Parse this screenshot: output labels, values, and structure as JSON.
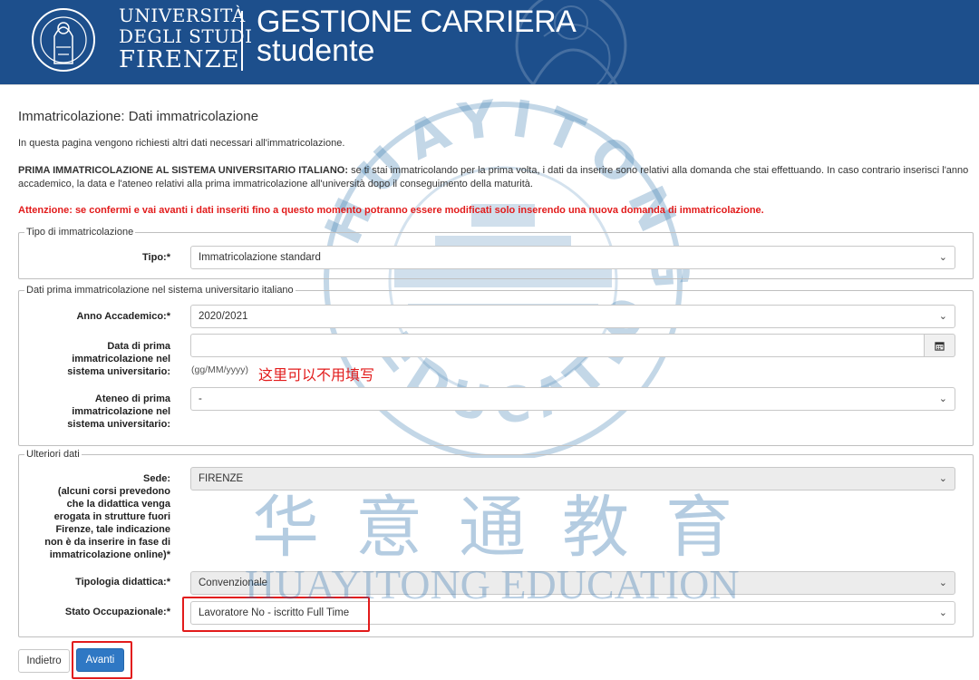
{
  "header": {
    "university_line1": "UNIVERSITÀ",
    "university_line2": "DEGLI STUDI",
    "university_line3": "FIRENZE",
    "seal_text": "FLORENTINUM STUDIORUM UNIVERSITAS",
    "app_title_line1": "GESTIONE CARRIERA",
    "app_title_line2": "studente"
  },
  "page": {
    "title": "Immatricolazione: Dati immatricolazione",
    "intro": "In questa pagina vengono richiesti altri dati necessari all'immatricolazione.",
    "first_enrollment_heading": "PRIMA IMMATRICOLAZIONE AL SISTEMA UNIVERSITARIO ITALIANO:",
    "first_enrollment_text": " se ti stai immatricolando per la prima volta, i dati da inserire sono relativi alla domanda che stai effettuando. In caso contrario inserisci l'anno accademico, la data e l'ateneo relativi alla prima immatricolazione all'università dopo il conseguimento della maturità.",
    "warning": "Attenzione: se confermi e vai avanti i dati inseriti fino a questo momento potranno essere modificati solo inserendo una nuova domanda di immatricolazione."
  },
  "section_type": {
    "legend": "Tipo di immatricolazione",
    "tipo_label": "Tipo:*",
    "tipo_value": "Immatricolazione standard"
  },
  "section_first": {
    "legend": "Dati prima immatricolazione nel sistema universitario italiano",
    "anno_label": "Anno Accademico:*",
    "anno_value": "2020/2021",
    "data_label_1": "Data di prima",
    "data_label_2": "immatricolazione nel",
    "data_label_3": "sistema universitario:",
    "data_value": "",
    "data_hint": "(gg/MM/yyyy)",
    "ateneo_label_1": "Ateneo di prima",
    "ateneo_label_2": "immatricolazione nel",
    "ateneo_label_3": "sistema universitario:",
    "ateneo_value": "-"
  },
  "section_more": {
    "legend": "Ulteriori dati",
    "sede_label_lines": [
      "Sede:",
      "(alcuni corsi prevedono",
      "che la didattica venga",
      "erogata in strutture fuori",
      "Firenze, tale indicazione",
      "non è da inserire in fase di",
      "immatricolazione online)*"
    ],
    "sede_value": "FIRENZE",
    "tipologia_label": "Tipologia didattica:*",
    "tipologia_value": "Convenzionale",
    "stato_label": "Stato Occupazionale:*",
    "stato_value": "Lavoratore No - iscritto Full Time"
  },
  "annotation": {
    "date_note": "这里可以不用填写"
  },
  "buttons": {
    "back": "Indietro",
    "next": "Avanti"
  },
  "watermark": {
    "circle_text": "HUAYITONG EDUCATION",
    "cn": "华意通教育",
    "en": "HUAYITONG EDUCATION"
  },
  "colors": {
    "header_bg": "#1d4f8c",
    "warning": "#e21b1b",
    "primary_button": "#2f78c4",
    "highlight": "#e21b1b"
  },
  "icons": {
    "calendar": "calendar-icon",
    "chevron": "chevron-down-icon"
  }
}
